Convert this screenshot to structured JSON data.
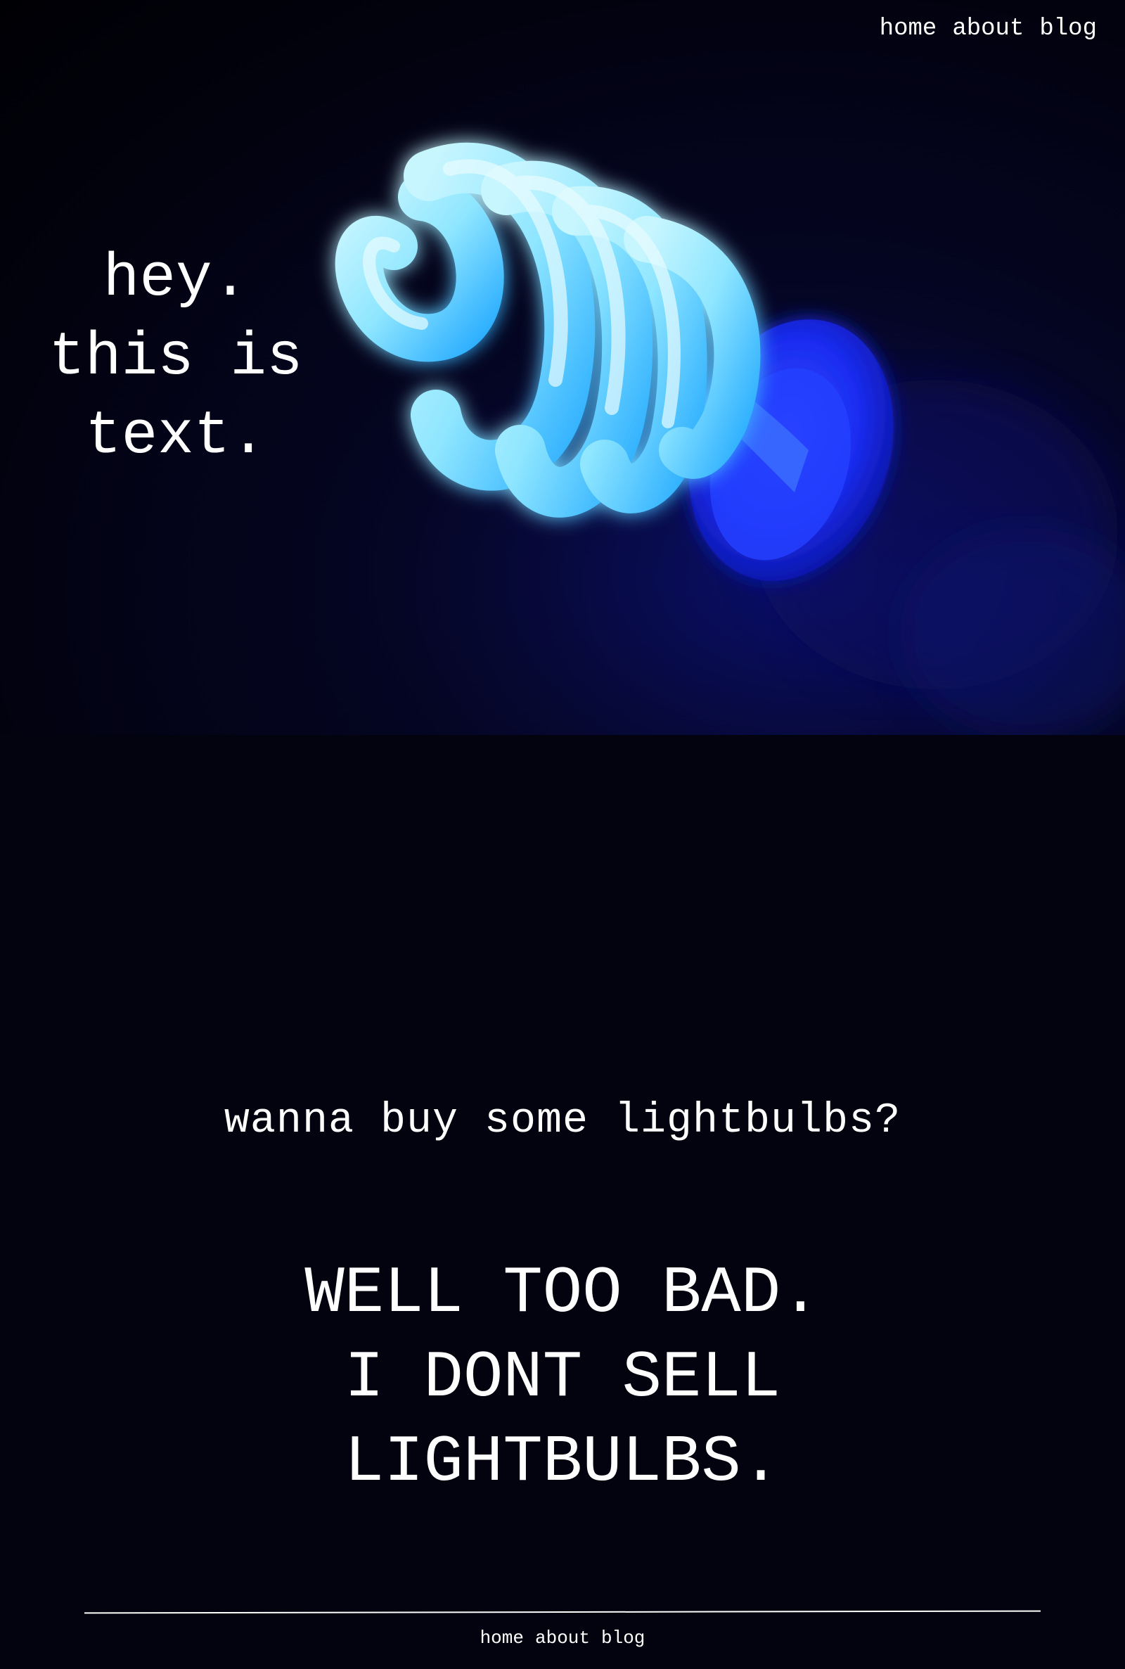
{
  "nav": {
    "home": "home",
    "about": "about",
    "blog": "blog"
  },
  "hero": {
    "lines": [
      "hey.",
      "this is",
      "text."
    ],
    "image": {
      "subject": "glowing spiral CFL lightbulb",
      "glow_color": "#7fe8ff",
      "base_color": "#1428ff"
    }
  },
  "main": {
    "question": "wanna buy some lightbulbs?",
    "answer_lines": [
      "WELL TOO BAD.",
      "I DONT SELL",
      "LIGHTBULBS."
    ]
  },
  "footer_nav": {
    "home": "home",
    "about": "about",
    "blog": "blog"
  },
  "colors": {
    "background": "#03030f",
    "text": "#ffffff"
  }
}
